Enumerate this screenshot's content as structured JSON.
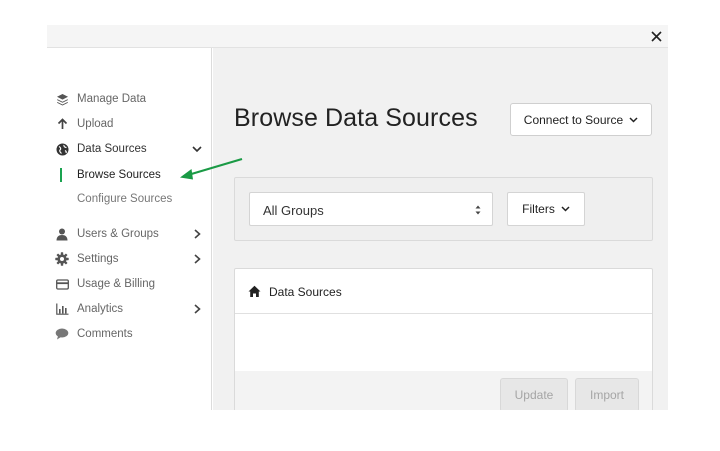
{
  "window": {
    "close_label": "×"
  },
  "sidebar": {
    "items": [
      {
        "label": "Manage Data",
        "icon": "layers-icon",
        "chevron": false
      },
      {
        "label": "Upload",
        "icon": "arrow-up-icon",
        "chevron": false
      },
      {
        "label": "Data Sources",
        "icon": "globe-icon",
        "chevron": "down"
      },
      {
        "label": "Users & Groups",
        "icon": "user-icon",
        "chevron": "right"
      },
      {
        "label": "Settings",
        "icon": "gear-icon",
        "chevron": "right"
      },
      {
        "label": "Usage & Billing",
        "icon": "credit-card-icon",
        "chevron": false
      },
      {
        "label": "Analytics",
        "icon": "bar-chart-icon",
        "chevron": "right"
      },
      {
        "label": "Comments",
        "icon": "speech-bubble-icon",
        "chevron": false
      }
    ],
    "sub_items": [
      {
        "label": "Browse Sources",
        "active": true
      },
      {
        "label": "Configure Sources",
        "active": false
      }
    ]
  },
  "main": {
    "title": "Browse Data Sources",
    "connect_button": "Connect to Source",
    "group_select": {
      "value": "All Groups"
    },
    "filters_button": "Filters",
    "data_sources_panel": {
      "title": "Data Sources",
      "update_button": "Update",
      "import_button": "Import"
    }
  },
  "colors": {
    "accent_green": "#1aa350",
    "main_bg": "#f1f1f1",
    "disabled_text": "#a5a5a5"
  }
}
